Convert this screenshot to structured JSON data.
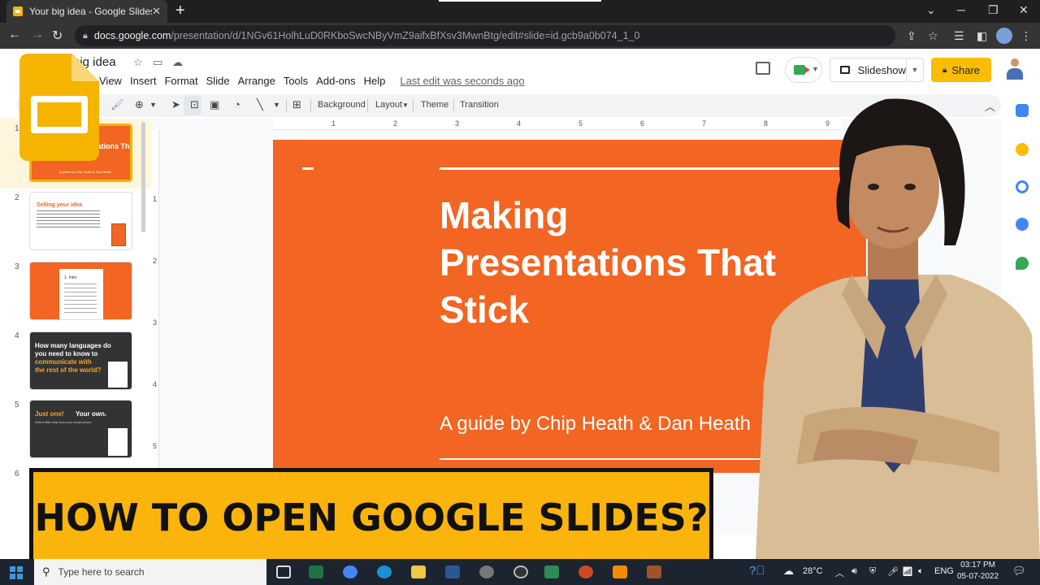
{
  "browser": {
    "tab_title": "Your big idea - Google Slides",
    "tab_close": "✕",
    "new_tab": "+",
    "url_domain": "docs.google.com",
    "url_path": "/presentation/d/1NGv61HolhLuD0RKboSwcNByVmZ9aifxBfXsv3MwnBtg/edit#slide=id.gcb9a0b074_1_0"
  },
  "doc": {
    "title": "big idea",
    "menu": [
      "View",
      "Insert",
      "Format",
      "Slide",
      "Arrange",
      "Tools",
      "Add-ons",
      "Help"
    ],
    "last_edit": "Last edit was seconds ago",
    "slideshow_label": "Slideshow",
    "share_label": "Share"
  },
  "toolbar": {
    "background": "Background",
    "layout": "Layout",
    "theme": "Theme",
    "transition": "Transition"
  },
  "ruler": {
    "h_ticks": [
      "1",
      "2",
      "3",
      "4",
      "5",
      "6",
      "7",
      "8",
      "9"
    ],
    "v_ticks": [
      "1",
      "2",
      "3",
      "4",
      "5"
    ]
  },
  "filmstrip": {
    "numbers": [
      "1",
      "2",
      "3",
      "4",
      "5",
      "6"
    ],
    "thumbs": [
      {
        "line1": "ntations That",
        "line2": "A guide by Chip Heath & Dan Heath"
      },
      {
        "heading": "Selling your idea"
      },
      {
        "heading": "1. Intro"
      },
      {
        "line1": "How many languages do",
        "line2": "you need to know to",
        "line3": "communicate with",
        "line4": "the rest of the world?"
      },
      {
        "line1": "Just one!",
        "line2": "Your own.",
        "line3": "With a little help from your smart phone"
      }
    ]
  },
  "slide": {
    "title": "Making\nPresentations That\nStick",
    "subtitle": "A guide by Chip Heath & Dan Heath"
  },
  "banner": {
    "text": "HOW TO OPEN GOOGLE SLIDES?"
  },
  "taskbar": {
    "search_placeholder": "Type here to search",
    "temperature": "28°C",
    "language": "ENG",
    "time": "03:17 PM",
    "date": "05-07-2022"
  },
  "colors": {
    "slide_orange": "#f26522",
    "banner_yellow": "#fbb40b",
    "share_yellow": "#fbbc04",
    "slides_logo": "#f4b400"
  }
}
